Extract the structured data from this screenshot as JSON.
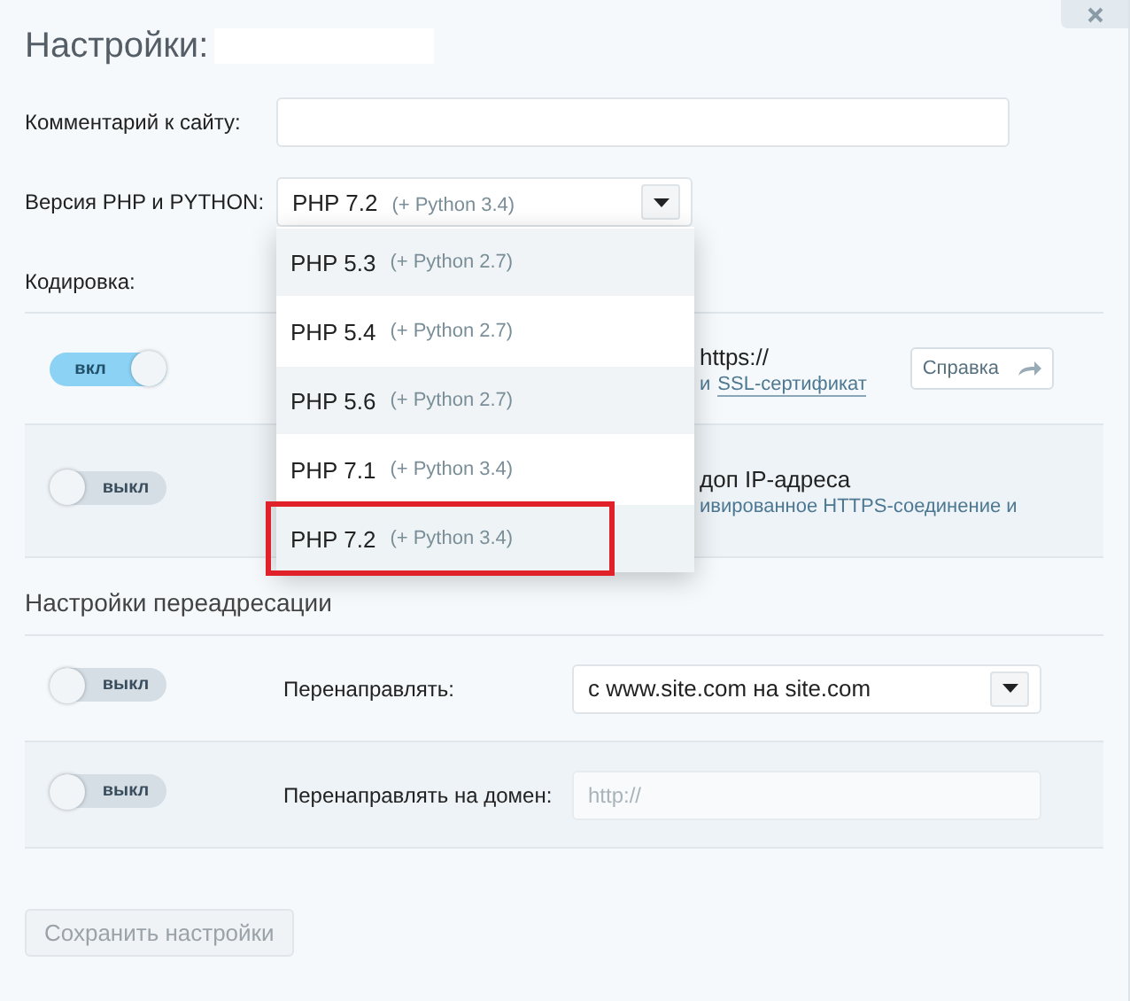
{
  "dialog": {
    "title": "Настройки:"
  },
  "comment": {
    "label": "Комментарий к сайту:"
  },
  "php": {
    "label": "Версия PHP и PYTHON:",
    "value": "PHP 7.2",
    "note": "(+ Python 3.4)",
    "expanded": true,
    "options": [
      {
        "php": "PHP 5.3",
        "python": "(+ Python 2.7)",
        "selected": false,
        "annotated": false
      },
      {
        "php": "PHP 5.4",
        "python": "(+ Python 2.7)",
        "selected": false,
        "annotated": false
      },
      {
        "php": "PHP 5.6",
        "python": "(+ Python 2.7)",
        "selected": false,
        "annotated": false
      },
      {
        "php": "PHP 7.1",
        "python": "(+ Python 3.4)",
        "selected": false,
        "annotated": false
      },
      {
        "php": "PHP 7.2",
        "python": "(+ Python 3.4)",
        "selected": true,
        "annotated": true
      }
    ]
  },
  "encoding": {
    "label": "Кодировка:"
  },
  "ssl_rows": [
    {
      "toggle": {
        "on": true,
        "label": "вкл"
      },
      "title": "https://",
      "prefix": "и",
      "link": "SSL-сертификат",
      "help": "Справка"
    },
    {
      "toggle": {
        "on": false,
        "label": "выкл"
      },
      "title": "доп IP-адреса",
      "text": "ивированное HTTPS-соединение и"
    }
  ],
  "redirect": {
    "heading": "Настройки переадресации",
    "rows": [
      {
        "kind": "select",
        "toggle": {
          "on": false,
          "label": "выкл"
        },
        "label": "Перенаправлять:",
        "value": "с www.site.com на site.com"
      },
      {
        "kind": "input",
        "toggle": {
          "on": false,
          "label": "выкл"
        },
        "label": "Перенаправлять на домен:",
        "placeholder": "http://"
      }
    ]
  },
  "save": {
    "label": "Сохранить настройки",
    "disabled": true
  }
}
